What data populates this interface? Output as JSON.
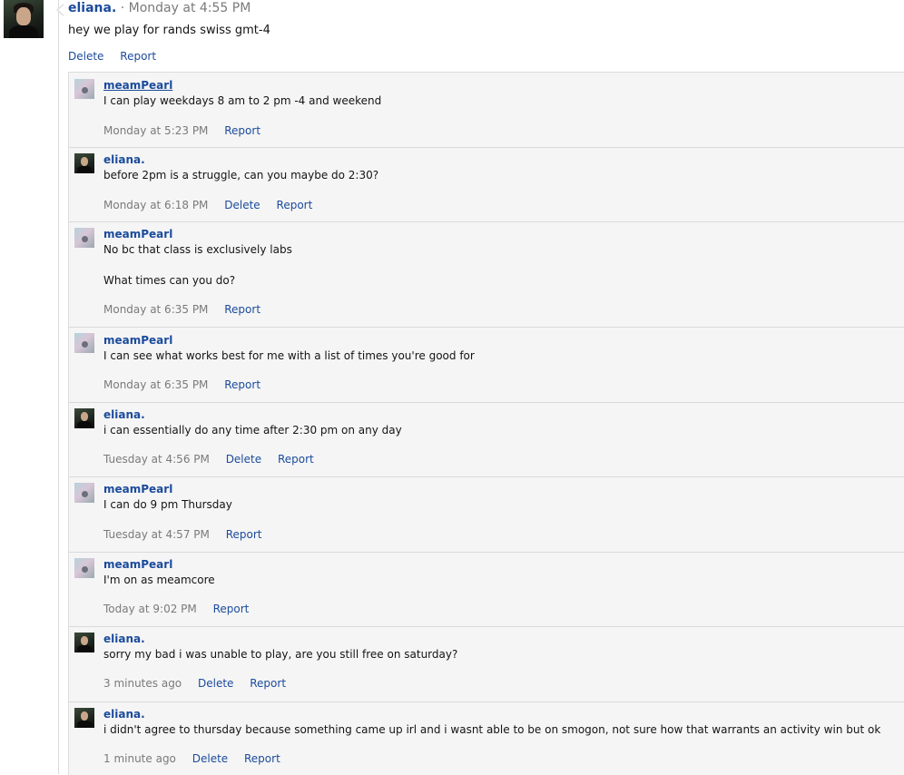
{
  "main_post": {
    "author": "eliana.",
    "separator": "·",
    "time": "Monday at 4:55 PM",
    "text": "hey we play for rands swiss gmt-4",
    "delete_label": "Delete",
    "report_label": "Report"
  },
  "comments": [
    {
      "author": "meamPearl",
      "text": "I can play weekdays 8 am to 2 pm -4 and weekend",
      "time": "Monday at 5:23 PM",
      "report": "Report"
    },
    {
      "author": "eliana.",
      "text": "before 2pm is a struggle, can you maybe do 2:30?",
      "time": "Monday at 6:18 PM",
      "delete": "Delete",
      "report": "Report"
    },
    {
      "author": "meamPearl",
      "text1": "No bc that class is exclusively labs",
      "text2": "What times can you do?",
      "time": "Monday at 6:35 PM",
      "report": "Report"
    },
    {
      "author": "meamPearl",
      "text": "I can see what works best for me with a list of times you're good for",
      "time": "Monday at 6:35 PM",
      "report": "Report"
    },
    {
      "author": "eliana.",
      "text": "i can essentially do any time after 2:30 pm on any day",
      "time": "Tuesday at 4:56 PM",
      "delete": "Delete",
      "report": "Report"
    },
    {
      "author": "meamPearl",
      "text": "I can do 9 pm Thursday",
      "time": "Tuesday at 4:57 PM",
      "report": "Report"
    },
    {
      "author": "meamPearl",
      "text": "I'm on as meamcore",
      "time": "Today at 9:02 PM",
      "report": "Report"
    },
    {
      "author": "eliana.",
      "text": "sorry my bad i was unable to play, are you still free on saturday?",
      "time": "3 minutes ago",
      "delete": "Delete",
      "report": "Report"
    },
    {
      "author": "eliana.",
      "text": "i didn't agree to thursday because something came up irl and i wasnt able to be on smogon, not sure how that warrants an activity win but ok",
      "time": "1 minute ago",
      "delete": "Delete",
      "report": "Report"
    }
  ]
}
